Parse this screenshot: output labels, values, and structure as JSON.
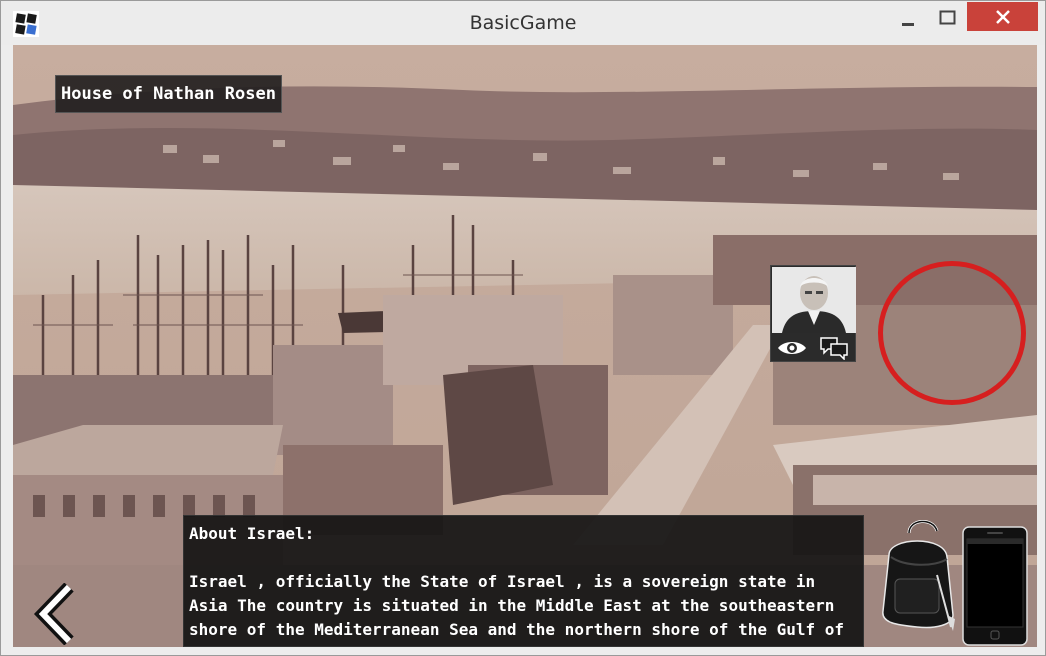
{
  "window": {
    "title": "BasicGame",
    "controls": [
      "minimize",
      "maximize",
      "close"
    ]
  },
  "scene": {
    "location_label": "House of Nathan Rosen",
    "description": "Sepia photograph of a historic harbour town with tall sailing ship masts, wooden buildings and hills across the water",
    "npc": {
      "name_icon": "portrait-of-nathan-rosen",
      "actions": [
        {
          "icon": "eye-icon",
          "action": "look"
        },
        {
          "icon": "chat-bubbles-icon",
          "action": "talk"
        }
      ]
    },
    "marker_color": "#d61f1f"
  },
  "info": {
    "title": "About Israel:",
    "text": "Israel , officially the State of Israel , is a sovereign state in Asia The country is situated in the Middle East at the southeastern shore of the Mediterranean Sea and the northern shore of the Gulf of Aqaba"
  },
  "inventory": {
    "backpack_icon": "backpack-icon",
    "phone_icon": "smartphone-icon"
  },
  "colors": {
    "close_button": "#c9423a",
    "sepia": "#b49e92"
  }
}
